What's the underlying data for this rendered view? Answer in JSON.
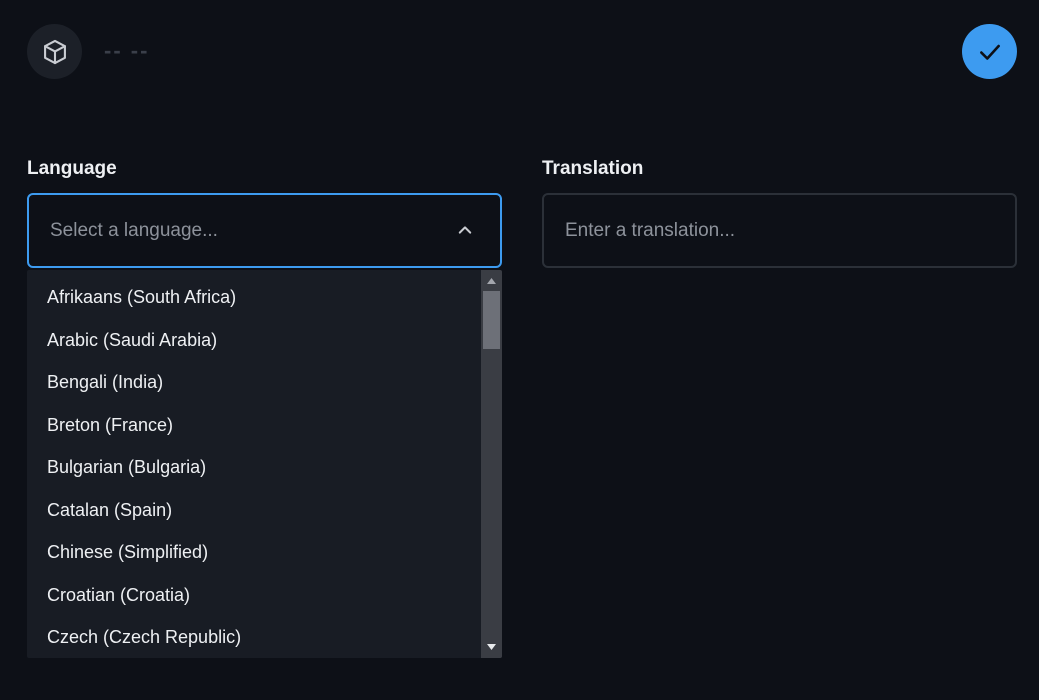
{
  "header": {
    "icon": "cube-icon",
    "title": "-- --"
  },
  "confirm": {
    "icon": "check-icon",
    "color": "#3d9bf0"
  },
  "language_field": {
    "label": "Language",
    "placeholder": "Select a language...",
    "expanded": true,
    "options": [
      "Afrikaans (South Africa)",
      "Arabic (Saudi Arabia)",
      "Bengali (India)",
      "Breton (France)",
      "Bulgarian (Bulgaria)",
      "Catalan (Spain)",
      "Chinese (Simplified)",
      "Croatian (Croatia)",
      "Czech (Czech Republic)"
    ]
  },
  "translation_field": {
    "label": "Translation",
    "placeholder": "Enter a translation..."
  },
  "colors": {
    "background": "#0d1017",
    "accent": "#3d9bf0",
    "dropdown_bg": "#181c24"
  }
}
